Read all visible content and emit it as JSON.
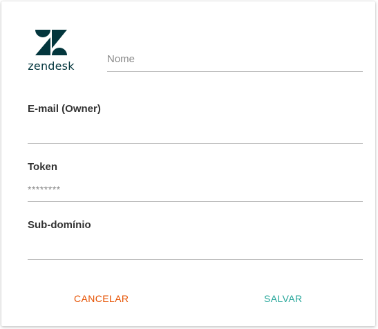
{
  "logo": {
    "icon": "zendesk-logo-icon",
    "text": "zendesk",
    "color": "#03363d"
  },
  "form": {
    "name": {
      "placeholder": "Nome",
      "value": ""
    },
    "email": {
      "label": "E-mail (Owner)",
      "value": ""
    },
    "token": {
      "label": "Token",
      "value": "********"
    },
    "subdomain": {
      "label": "Sub-domínio",
      "value": ""
    }
  },
  "actions": {
    "cancel_label": "CANCELAR",
    "cancel_color": "#e65100",
    "save_label": "SALVAR",
    "save_color": "#26a69a"
  }
}
